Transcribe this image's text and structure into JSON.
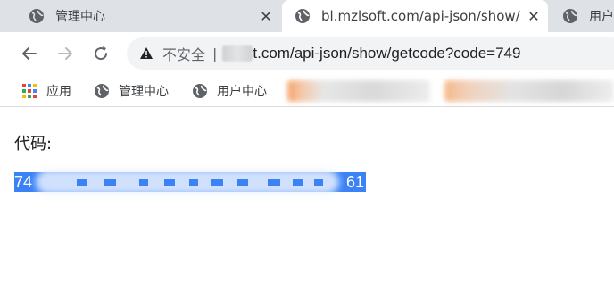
{
  "tabs": [
    {
      "title": "管理中心",
      "active": false,
      "close": "✕"
    },
    {
      "title": "bl.mzlsoft.com/api-json/show/",
      "active": true,
      "close": "✕"
    },
    {
      "title": "用户",
      "active": false
    }
  ],
  "toolbar": {
    "back": "back-arrow-icon",
    "forward": "forward-arrow-icon",
    "reload": "reload-icon",
    "security_label": "不安全",
    "divider": "|",
    "url_visible": "t.com/api-json/show/getcode?code=749"
  },
  "bookmarks": [
    {
      "label": "应用",
      "icon": "apps-grid-icon"
    },
    {
      "label": "管理中心",
      "icon": "globe-icon"
    },
    {
      "label": "用户中心",
      "icon": "globe-icon"
    }
  ],
  "page": {
    "label": "代码:",
    "code_start": "74",
    "code_end": "61"
  },
  "colors": {
    "tabstrip": "#dee1e6",
    "omnibox": "#f1f3f4",
    "selection": "#3b82f6"
  }
}
